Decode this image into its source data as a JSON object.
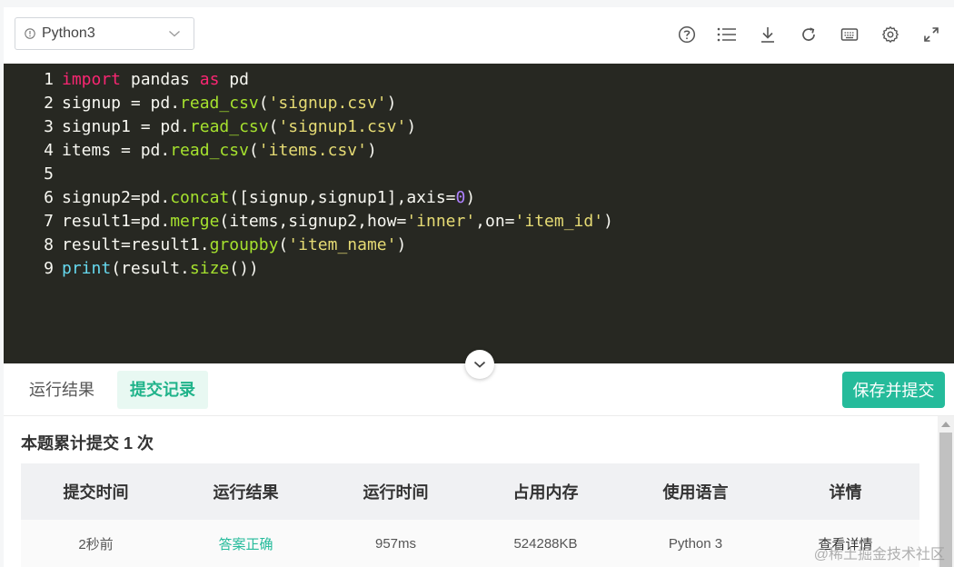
{
  "toolbar": {
    "language": "Python3",
    "icons": [
      "help-icon",
      "list-icon",
      "download-icon",
      "refresh-icon",
      "keyboard-icon",
      "settings-icon",
      "fullscreen-icon"
    ]
  },
  "editor": {
    "lines": [
      {
        "no": "1",
        "tokens": [
          {
            "t": "import",
            "c": "kw"
          },
          {
            "t": " pandas "
          },
          {
            "t": "as",
            "c": "kw"
          },
          {
            "t": " pd"
          }
        ]
      },
      {
        "no": "2",
        "tokens": [
          {
            "t": "signup = pd."
          },
          {
            "t": "read_csv",
            "c": "fn"
          },
          {
            "t": "("
          },
          {
            "t": "'signup.csv'",
            "c": "str"
          },
          {
            "t": ")"
          }
        ]
      },
      {
        "no": "3",
        "tokens": [
          {
            "t": "signup1 = pd."
          },
          {
            "t": "read_csv",
            "c": "fn"
          },
          {
            "t": "("
          },
          {
            "t": "'signup1.csv'",
            "c": "str"
          },
          {
            "t": ")"
          }
        ]
      },
      {
        "no": "4",
        "tokens": [
          {
            "t": "items = pd."
          },
          {
            "t": "read_csv",
            "c": "fn"
          },
          {
            "t": "("
          },
          {
            "t": "'items.csv'",
            "c": "str"
          },
          {
            "t": ")"
          }
        ]
      },
      {
        "no": "5",
        "tokens": []
      },
      {
        "no": "6",
        "tokens": [
          {
            "t": "signup2=pd."
          },
          {
            "t": "concat",
            "c": "fn"
          },
          {
            "t": "([signup,signup1],axis="
          },
          {
            "t": "0",
            "c": "num"
          },
          {
            "t": ")"
          }
        ]
      },
      {
        "no": "7",
        "tokens": [
          {
            "t": "result1=pd."
          },
          {
            "t": "merge",
            "c": "fn"
          },
          {
            "t": "(items,signup2,how="
          },
          {
            "t": "'inner'",
            "c": "str"
          },
          {
            "t": ",on="
          },
          {
            "t": "'item_id'",
            "c": "str"
          },
          {
            "t": ")"
          }
        ]
      },
      {
        "no": "8",
        "tokens": [
          {
            "t": "result=result1."
          },
          {
            "t": "groupby",
            "c": "fn"
          },
          {
            "t": "("
          },
          {
            "t": "'item_name'",
            "c": "str"
          },
          {
            "t": ")"
          }
        ]
      },
      {
        "no": "9",
        "tokens": [
          {
            "t": "print",
            "c": "bi"
          },
          {
            "t": "(result."
          },
          {
            "t": "size",
            "c": "fn"
          },
          {
            "t": "())"
          }
        ]
      }
    ]
  },
  "tabs": {
    "run_result": "运行结果",
    "submit_record": "提交记录"
  },
  "submit_button": "保存并提交",
  "records": {
    "count_text": "本题累计提交 1 次",
    "headers": [
      "提交时间",
      "运行结果",
      "运行时间",
      "占用内存",
      "使用语言",
      "详情"
    ],
    "rows": [
      [
        "2秒前",
        "答案正确",
        "957ms",
        "524288KB",
        "Python 3",
        "查看详情"
      ]
    ]
  },
  "watermark": "@稀土掘金技术社区",
  "colors": {
    "accent": "#25bb9b",
    "editor_bg": "#272822"
  }
}
